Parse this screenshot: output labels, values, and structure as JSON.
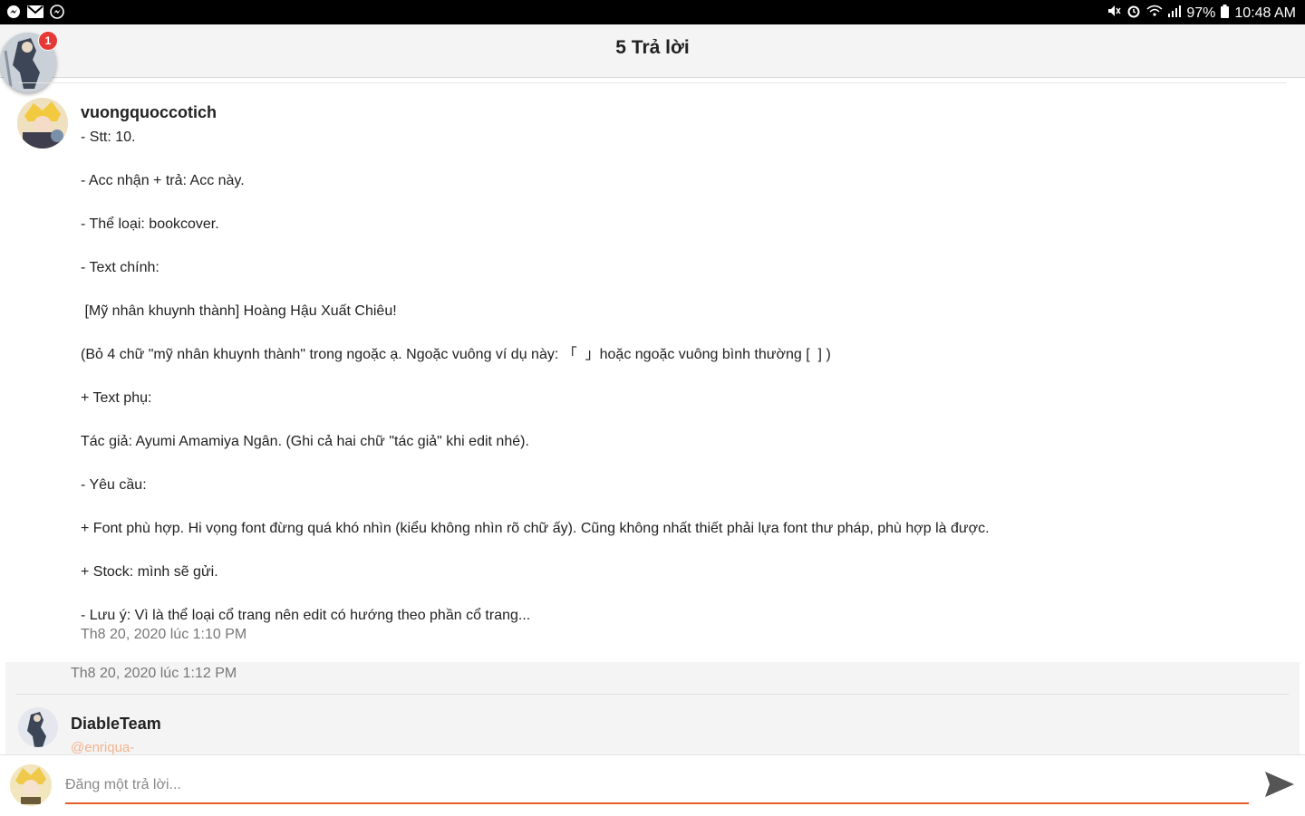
{
  "status_bar": {
    "left_icons": [
      "messenger-icon",
      "gmail-icon",
      "messenger-icon"
    ],
    "battery": "97%",
    "time": "10:48 AM"
  },
  "header": {
    "title": "5 Trả lời",
    "notification_count": "1"
  },
  "post": {
    "author": "vuongquoccotich",
    "lines": [
      "- Stt: 10.",
      "- Acc nhận + trả: Acc này.",
      "- Thể loại: bookcover.",
      "- Text chính:",
      " [Mỹ nhân khuynh thành] Hoàng Hậu Xuất Chiêu!",
      "(Bỏ 4 chữ \"mỹ nhân khuynh thành\" trong ngoặc ạ. Ngoặc vuông ví dụ này: 「  」hoặc ngoặc vuông bình thường [  ] )",
      "+ Text phụ:",
      "Tác giả: Ayumi Amamiya Ngân. (Ghi cả hai chữ \"tác giả\" khi edit nhé).",
      "- Yêu cầu:",
      "+ Font phù hợp. Hi vọng font đừng quá khó nhìn (kiểu không nhìn rõ chữ ấy). Cũng không nhất thiết phải lựa font thư pháp, phù hợp là được.",
      "+ Stock: mình sẽ gửi.",
      "- Lưu ý: Vì là thể loại cổ trang nên edit có hướng theo phần cổ trang..."
    ],
    "timestamp": "Th8 20, 2020 lúc 1:10 PM"
  },
  "reply_section": {
    "timestamp": "Th8 20, 2020 lúc 1:12 PM",
    "author": "DiableTeam",
    "mention": "@enriqua-"
  },
  "composer": {
    "placeholder": "Đăng một trả lời..."
  },
  "colors": {
    "accent": "#e85d2a",
    "header_bg": "#f4f4f4",
    "badge": "#e53935"
  }
}
